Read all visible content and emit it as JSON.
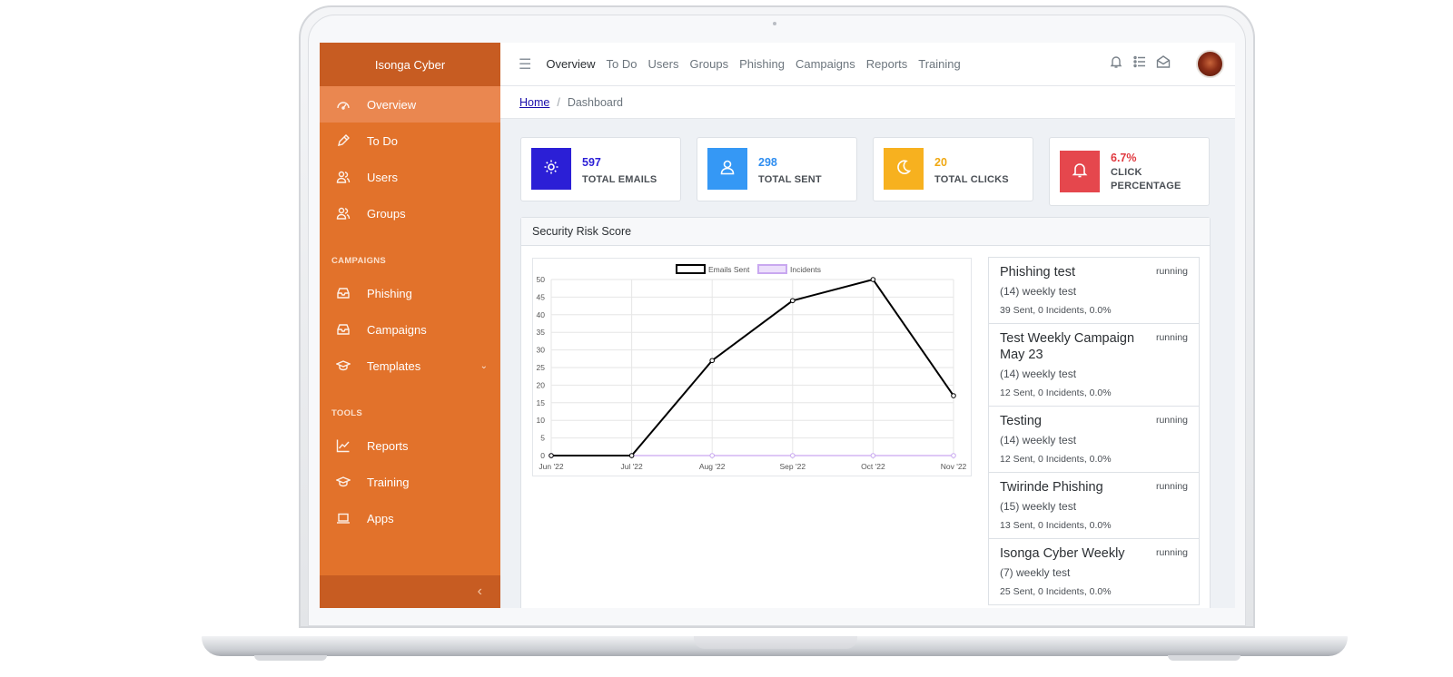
{
  "sidebar": {
    "brand": "Isonga Cyber",
    "items": [
      {
        "label": "Overview"
      },
      {
        "label": "To Do"
      },
      {
        "label": "Users"
      },
      {
        "label": "Groups"
      }
    ],
    "section_campaigns": "CAMPAIGNS",
    "campaign_items": [
      {
        "label": "Phishing"
      },
      {
        "label": "Campaigns"
      },
      {
        "label": "Templates"
      }
    ],
    "section_tools": "TOOLS",
    "tool_items": [
      {
        "label": "Reports"
      },
      {
        "label": "Training"
      },
      {
        "label": "Apps"
      }
    ],
    "collapse_glyph": "‹"
  },
  "topbar": {
    "menu_glyph": "☰",
    "links": [
      "Overview",
      "To Do",
      "Users",
      "Groups",
      "Phishing",
      "Campaigns",
      "Reports",
      "Training"
    ]
  },
  "breadcrumb": {
    "home": "Home",
    "separator": "/",
    "current": "Dashboard"
  },
  "stats": [
    {
      "value": "597",
      "label": "TOTAL EMAILS",
      "color": "#2b1fd6",
      "text_color": "#2b1fd6",
      "icon": "gear-icon"
    },
    {
      "value": "298",
      "label": "TOTAL SENT",
      "color": "#3598f5",
      "text_color": "#2e8df0",
      "icon": "user-icon"
    },
    {
      "value": "20",
      "label": "TOTAL CLICKS",
      "color": "#f7b11f",
      "text_color": "#f0a812",
      "icon": "moon-icon"
    },
    {
      "value": "6.7%",
      "label": "CLICK PERCENTAGE",
      "label_lines": [
        "CLICK",
        "PERCENTAGE"
      ],
      "color": "#e5474d",
      "text_color": "#e0393f",
      "icon": "bell-icon"
    }
  ],
  "panel": {
    "title": "Security Risk Score"
  },
  "chart_data": {
    "type": "line",
    "x": [
      "Jun '22",
      "Jul '22",
      "Aug '22",
      "Sep '22",
      "Oct '22",
      "Nov '22"
    ],
    "series": [
      {
        "name": "Emails Sent",
        "values": [
          0,
          0,
          27,
          44,
          50,
          17
        ],
        "color": "#000000"
      },
      {
        "name": "Incidents",
        "values": [
          0,
          0,
          0,
          0,
          0,
          0
        ],
        "color": "#c9a8f0"
      }
    ],
    "ylim": [
      0,
      50
    ],
    "yticks": [
      0,
      5,
      10,
      15,
      20,
      25,
      30,
      35,
      40,
      45,
      50
    ],
    "grid": true,
    "legend": "top"
  },
  "campaigns": [
    {
      "title": "Phishing test",
      "status": "running",
      "subtitle": "(14) weekly test",
      "meta": "39 Sent, 0 Incidents, 0.0%"
    },
    {
      "title": "Test Weekly Campaign May 23",
      "status": "running",
      "subtitle": "(14) weekly test",
      "meta": "12 Sent, 0 Incidents, 0.0%"
    },
    {
      "title": "Testing",
      "status": "running",
      "subtitle": "(14) weekly test",
      "meta": "12 Sent, 0 Incidents, 0.0%"
    },
    {
      "title": "Twirinde Phishing",
      "status": "running",
      "subtitle": "(15) weekly test",
      "meta": "13 Sent, 0 Incidents, 0.0%"
    },
    {
      "title": "Isonga Cyber Weekly",
      "status": "running",
      "subtitle": "(7) weekly test",
      "meta": "25 Sent, 0 Incidents, 0.0%"
    }
  ]
}
